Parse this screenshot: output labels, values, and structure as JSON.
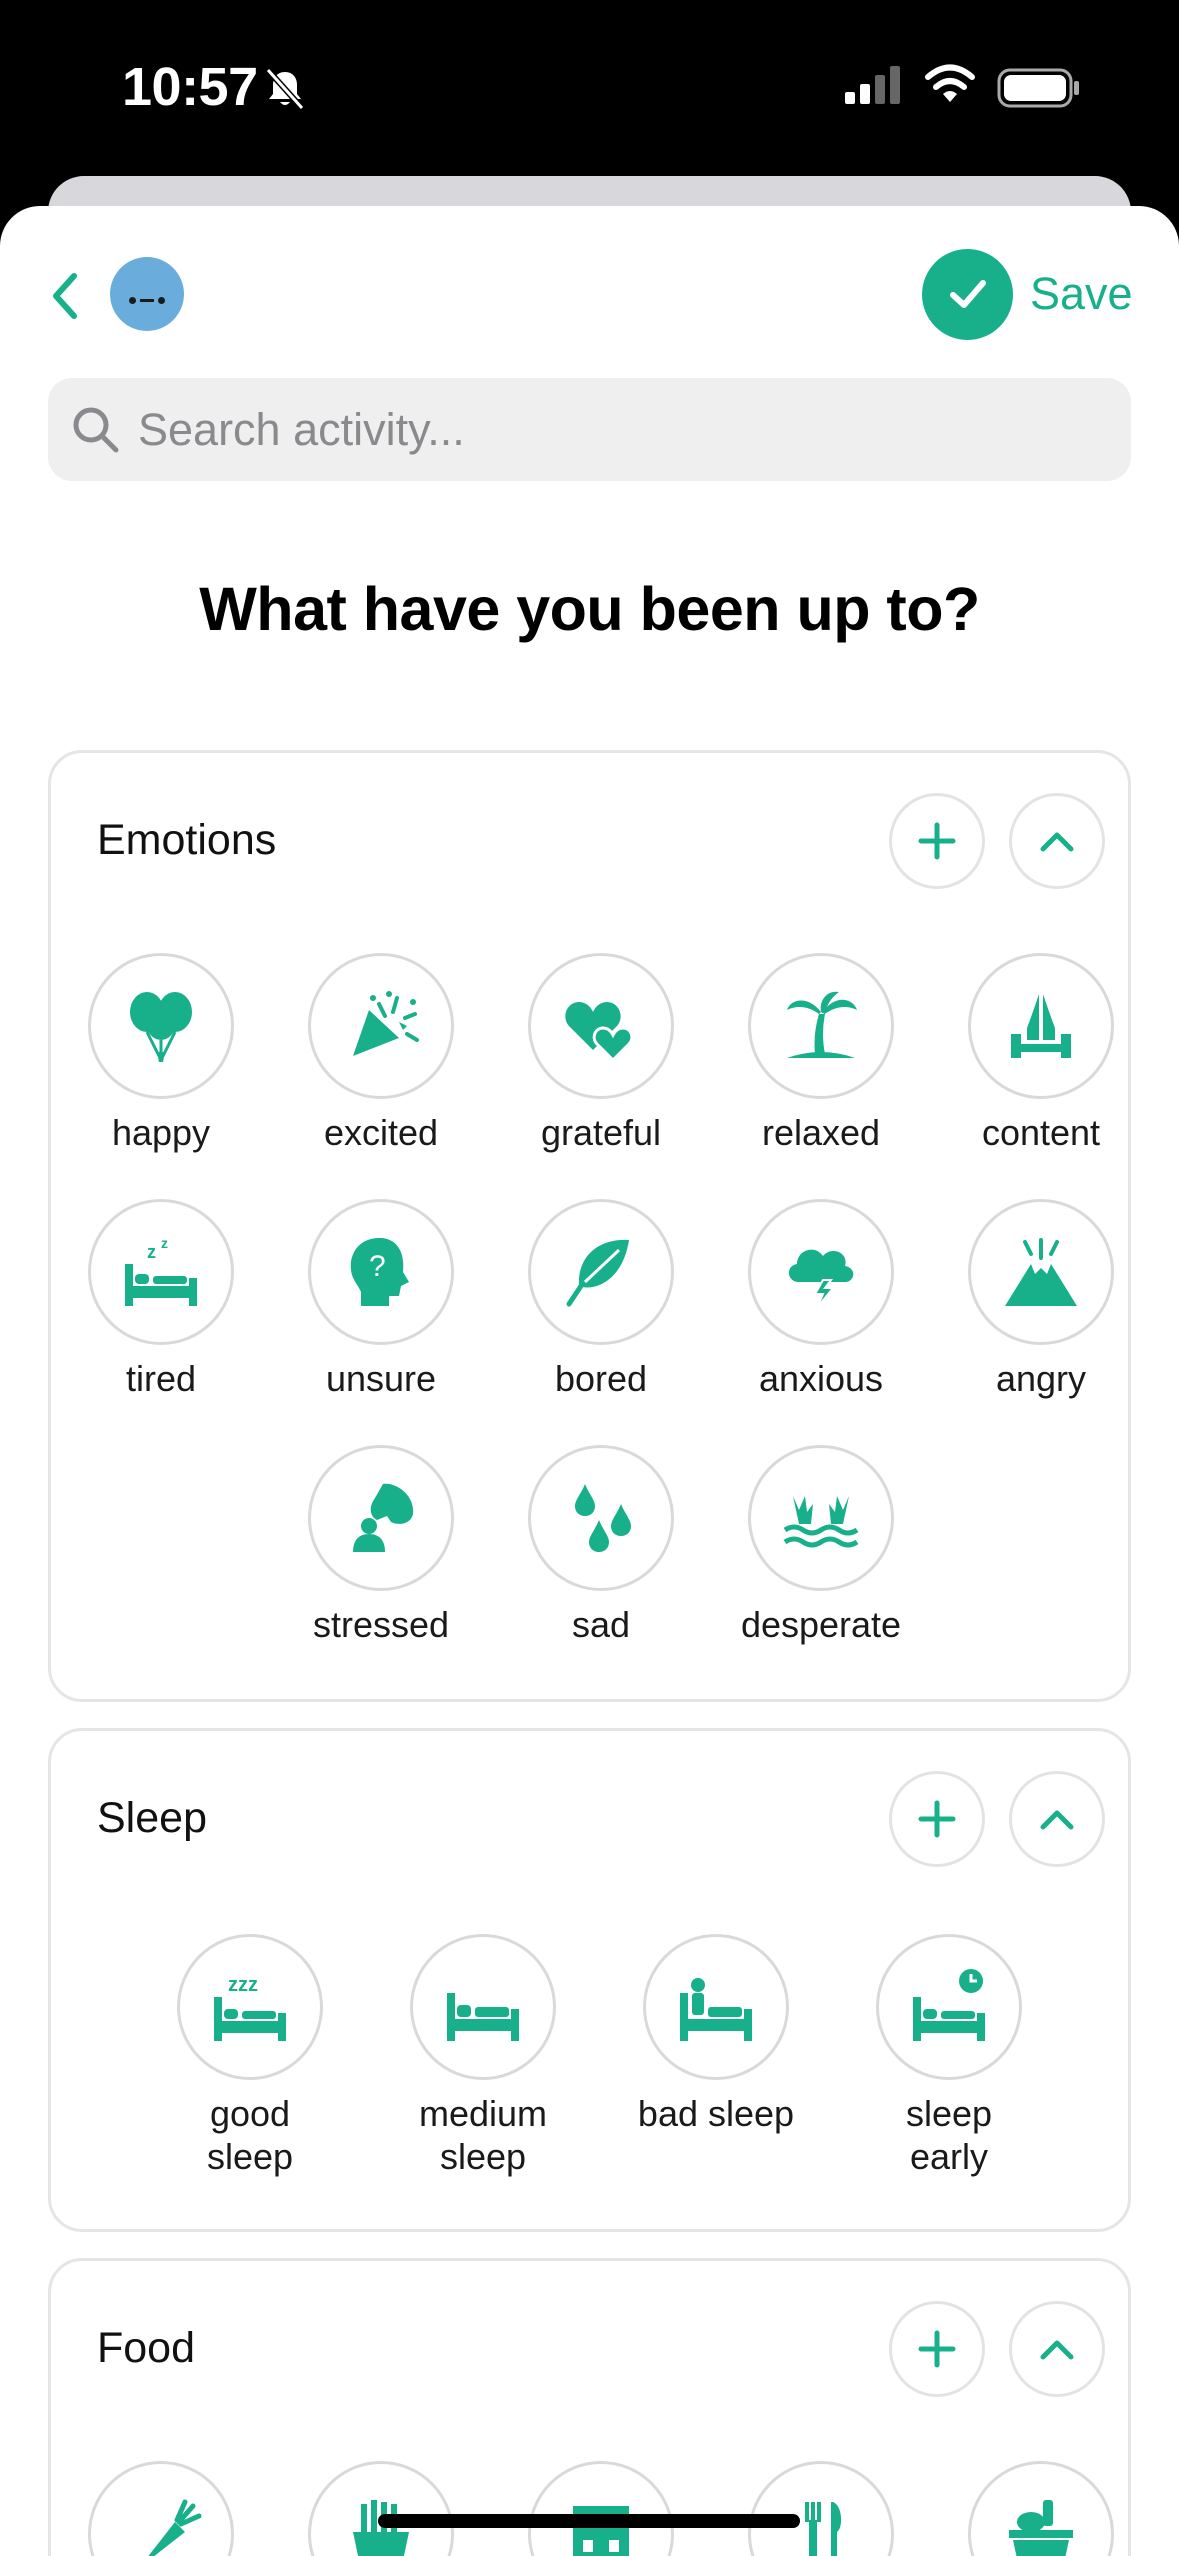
{
  "status_bar": {
    "time": "10:57"
  },
  "header": {
    "save_label": "Save",
    "search_placeholder": "Search activity...",
    "title": "What have you been up to?"
  },
  "colors": {
    "accent": "#17b08a",
    "mood": "#6aaddd",
    "border": "#e5e5e5"
  },
  "emotions": {
    "title": "Emotions",
    "items": [
      {
        "label": "happy",
        "icon": "balloons-icon"
      },
      {
        "label": "excited",
        "icon": "party-popper-icon"
      },
      {
        "label": "grateful",
        "icon": "hearts-icon"
      },
      {
        "label": "relaxed",
        "icon": "palm-tree-icon"
      },
      {
        "label": "content",
        "icon": "praying-hands-icon"
      },
      {
        "label": "tired",
        "icon": "bed-zz-icon"
      },
      {
        "label": "unsure",
        "icon": "head-question-icon"
      },
      {
        "label": "bored",
        "icon": "leaf-icon"
      },
      {
        "label": "anxious",
        "icon": "storm-cloud-icon"
      },
      {
        "label": "angry",
        "icon": "volcano-icon"
      },
      {
        "label": "stressed",
        "icon": "hand-squeeze-icon"
      },
      {
        "label": "sad",
        "icon": "tears-icon"
      },
      {
        "label": "desperate",
        "icon": "drowning-hands-icon"
      }
    ]
  },
  "sleep": {
    "title": "Sleep",
    "items": [
      {
        "label": "good sleep",
        "icon": "bed-zzz-icon"
      },
      {
        "label": "medium sleep",
        "icon": "bed-icon"
      },
      {
        "label": "bad sleep",
        "icon": "bed-sitting-icon"
      },
      {
        "label": "sleep early",
        "icon": "bed-clock-icon"
      }
    ]
  },
  "food": {
    "title": "Food",
    "items": [
      {
        "label": "",
        "icon": "carrot-icon"
      },
      {
        "label": "",
        "icon": "fries-icon"
      },
      {
        "label": "",
        "icon": "restaurant-icon"
      },
      {
        "label": "",
        "icon": "cutlery-icon"
      },
      {
        "label": "",
        "icon": "groceries-icon"
      }
    ]
  }
}
